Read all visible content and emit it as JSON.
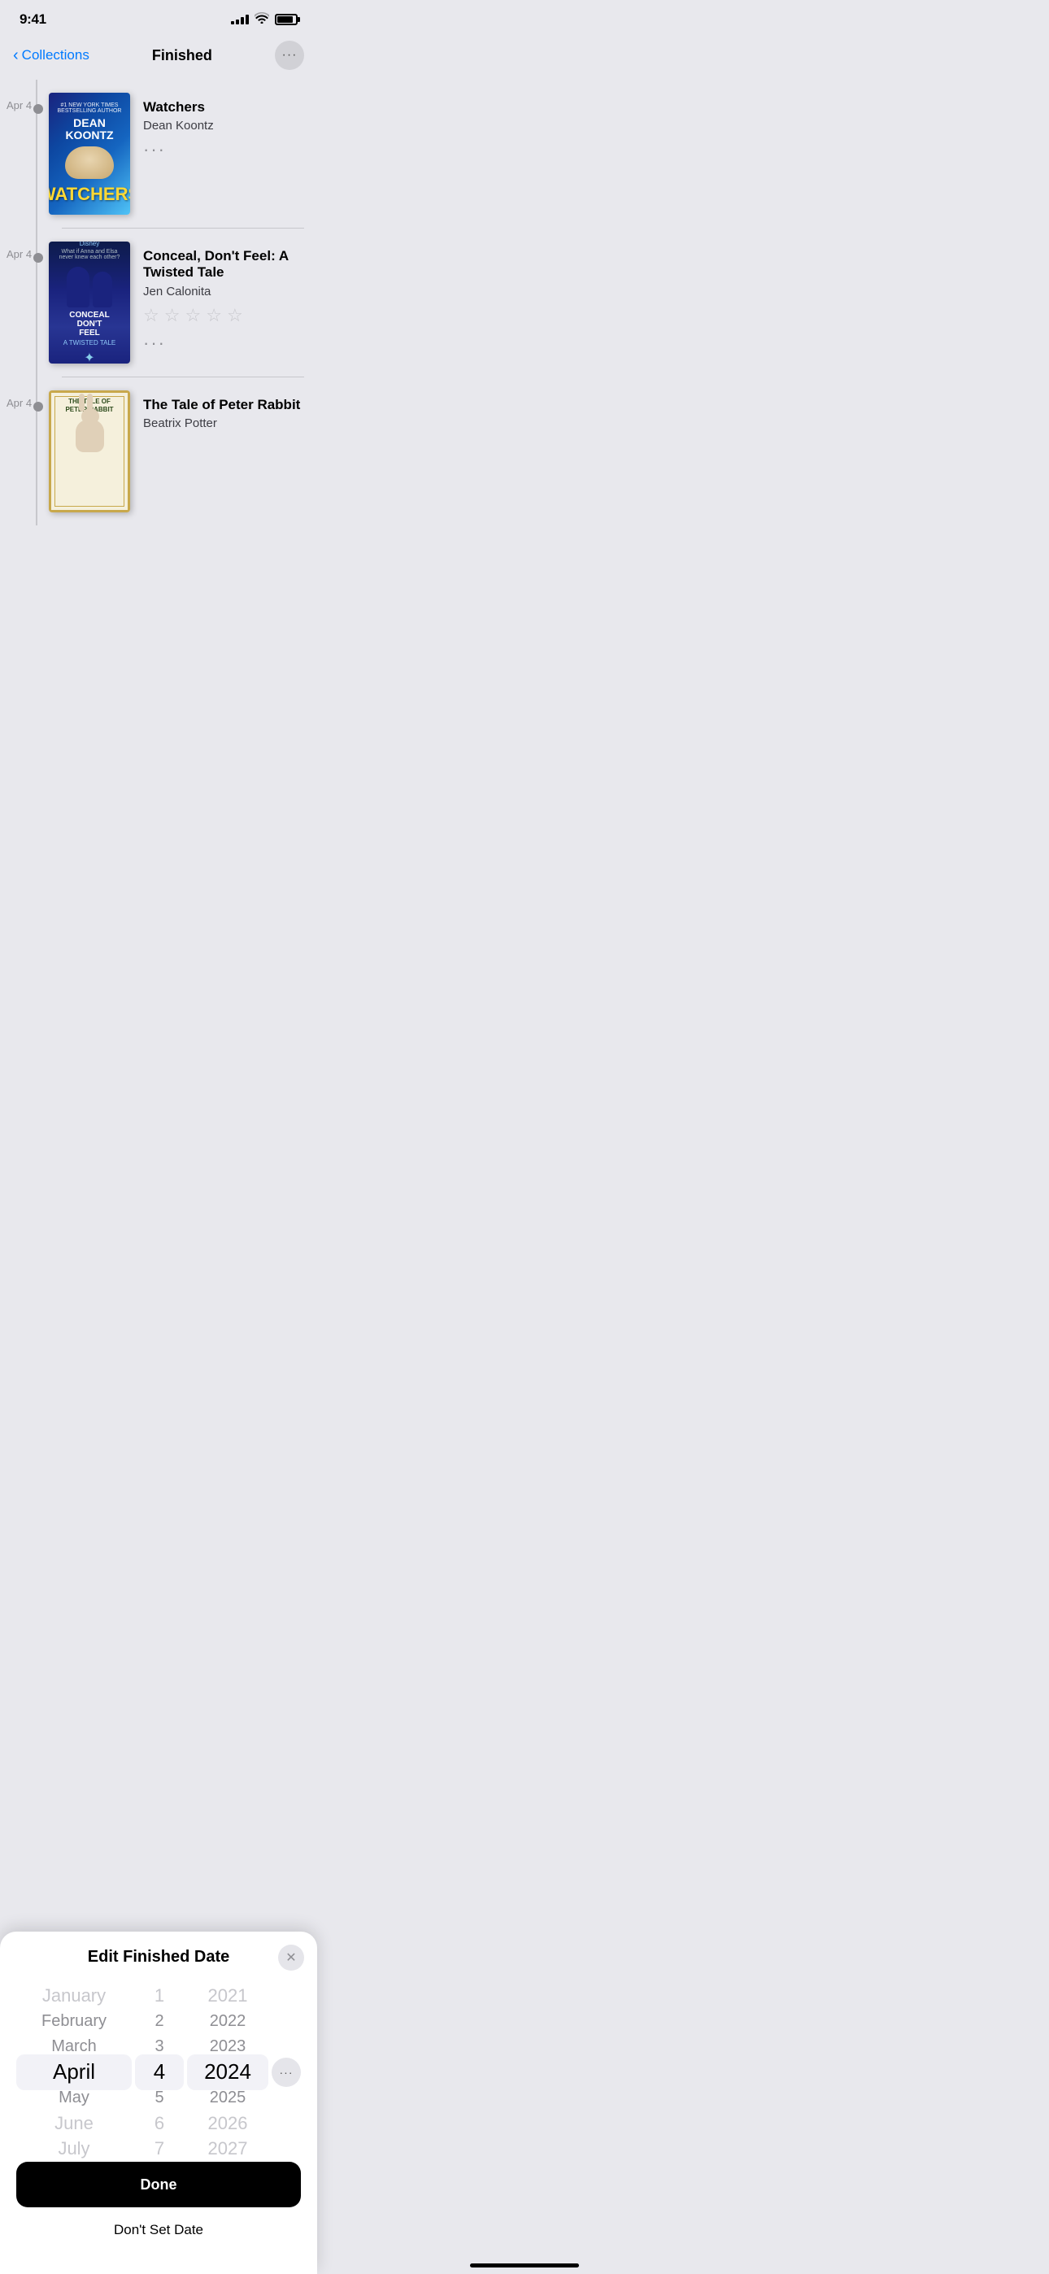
{
  "status": {
    "time": "9:41",
    "signal_bars": [
      3,
      5,
      7,
      9,
      11
    ],
    "wifi": "wifi",
    "battery": 85
  },
  "nav": {
    "back_label": "Collections",
    "title": "Finished",
    "more_label": "···"
  },
  "books": [
    {
      "date": "Apr 4",
      "title": "Watchers",
      "author": "Dean Koontz",
      "cover_type": "watchers",
      "has_stars": false,
      "has_more": true
    },
    {
      "date": "Apr 4",
      "title": "Conceal, Don't Feel: A Twisted Tale",
      "author": "Jen Calonita",
      "cover_type": "conceal",
      "has_stars": true,
      "has_more": true
    },
    {
      "date": "Apr 4",
      "title": "The Tale of Peter Rabbit",
      "author": "Beatrix Potter",
      "cover_type": "peter",
      "has_stars": false,
      "has_more": false
    }
  ],
  "sheet": {
    "title": "Edit Finished Date",
    "close_label": "✕",
    "months": [
      "January",
      "February",
      "March",
      "April",
      "May",
      "June",
      "July"
    ],
    "days": [
      "1",
      "2",
      "3",
      "4",
      "5",
      "6",
      "7"
    ],
    "years": [
      "2021",
      "2022",
      "2023",
      "2024",
      "2025",
      "2026",
      "2027"
    ],
    "selected_month": "April",
    "selected_day": "4",
    "selected_year": "2024",
    "done_label": "Done",
    "no_date_label": "Don't Set Date"
  }
}
